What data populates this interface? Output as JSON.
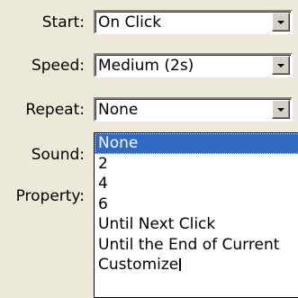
{
  "fields": {
    "start": {
      "label": "Start:",
      "value": "On Click"
    },
    "speed": {
      "label": "Speed:",
      "value": "Medium (2s)"
    },
    "repeat": {
      "label": "Repeat:",
      "value": "None"
    },
    "sound": {
      "label": "Sound:"
    },
    "property": {
      "label": "Property:"
    }
  },
  "repeat_dropdown": {
    "options": [
      "None",
      "2",
      "4",
      "6",
      "Until Next Click",
      "Until the End of Current",
      "Customize"
    ],
    "selected_index": 0
  },
  "icons": {
    "dropdown_arrow": "chevron-down-icon"
  }
}
